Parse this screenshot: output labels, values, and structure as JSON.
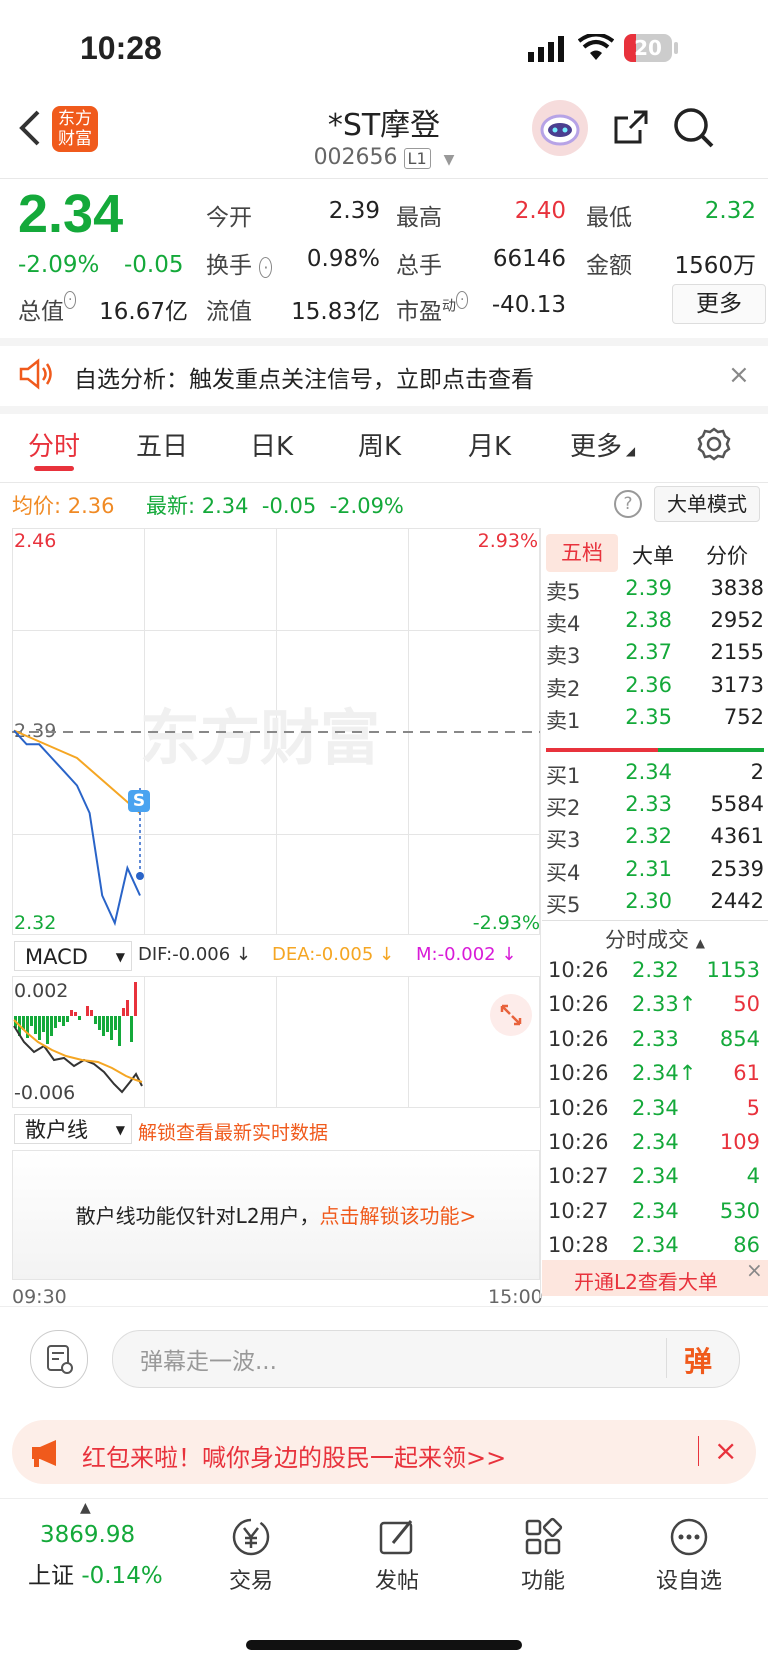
{
  "status": {
    "time": "10:28",
    "battery": "20"
  },
  "header": {
    "logo": "东方财富",
    "title": "*ST摩登",
    "code": "002656",
    "level": "L1"
  },
  "quote": {
    "price": "2.34",
    "change_pct": "-2.09%",
    "change": "-0.05",
    "open_label": "今开",
    "open": "2.39",
    "high_label": "最高",
    "high": "2.40",
    "low_label": "最低",
    "low": "2.32",
    "turnover_label": "换手",
    "turnover": "0.98%",
    "volume_label": "总手",
    "volume": "66146",
    "amount_label": "金额",
    "amount": "1560万",
    "mktcap_label": "总值",
    "mktcap": "16.67亿",
    "float_label": "流值",
    "float_cap": "15.83亿",
    "pe_label": "市盈",
    "pe_sup": "动",
    "pe": "-40.13",
    "more": "更多"
  },
  "notice": {
    "text": "自选分析：触发重点关注信号，立即点击查看"
  },
  "tabs": [
    "分时",
    "五日",
    "日K",
    "周K",
    "月K",
    "更多"
  ],
  "info_line": {
    "avg_label": "均价:",
    "avg": "2.36",
    "latest_label": "最新:",
    "latest": "2.34",
    "change": "-0.05",
    "pct": "-2.09%",
    "mode": "大单模式"
  },
  "chart": {
    "y_top": "2.46",
    "y_bottom": "2.32",
    "pct_top": "2.93%",
    "pct_bottom": "-2.93%",
    "ref_price": "2.39",
    "watermark": "东方财富",
    "time_start": "09:30",
    "time_end": "15:00",
    "s_marker": "S"
  },
  "chart_data": {
    "type": "line",
    "series": [
      {
        "values": [
          2.39,
          2.385,
          2.385,
          2.38,
          2.375,
          2.37,
          2.36,
          2.33,
          2.32,
          2.34,
          2.33
        ]
      },
      {
        "values": [
          2.39,
          2.388,
          2.386,
          2.384,
          2.382,
          2.38,
          2.376,
          2.372,
          2.368,
          2.364,
          2.36
        ]
      }
    ],
    "ylim": [
      2.32,
      2.46
    ],
    "x": [
      "09:30",
      "15:00"
    ]
  },
  "macd": {
    "name": "MACD",
    "dif": "DIF:-0.006 ↓",
    "dea": "DEA:-0.005 ↓",
    "m": "M:-0.002 ↓",
    "top": "0.002",
    "bottom": "-0.006"
  },
  "retail": {
    "name": "散户线",
    "unlock_link": "解锁查看最新实时数据",
    "msg": "散户线功能仅针对L2用户，",
    "msg_link": "点击解锁该功能>"
  },
  "orderbook": {
    "tabs": [
      "五档",
      "大单",
      "分价"
    ],
    "asks": [
      {
        "label": "卖5",
        "price": "2.39",
        "vol": "3838"
      },
      {
        "label": "卖4",
        "price": "2.38",
        "vol": "2952"
      },
      {
        "label": "卖3",
        "price": "2.37",
        "vol": "2155"
      },
      {
        "label": "卖2",
        "price": "2.36",
        "vol": "3173"
      },
      {
        "label": "卖1",
        "price": "2.35",
        "vol": "752"
      }
    ],
    "bids": [
      {
        "label": "买1",
        "price": "2.34",
        "vol": "2"
      },
      {
        "label": "买2",
        "price": "2.33",
        "vol": "5584"
      },
      {
        "label": "买3",
        "price": "2.32",
        "vol": "4361"
      },
      {
        "label": "买4",
        "price": "2.31",
        "vol": "2539"
      },
      {
        "label": "买5",
        "price": "2.30",
        "vol": "2442"
      }
    ]
  },
  "trades": {
    "title": "分时成交",
    "rows": [
      {
        "time": "10:26",
        "price": "2.32",
        "vol": "1153"
      },
      {
        "time": "10:26",
        "price": "2.33↑",
        "vol": "50"
      },
      {
        "time": "10:26",
        "price": "2.33",
        "vol": "854"
      },
      {
        "time": "10:26",
        "price": "2.34↑",
        "vol": "61"
      },
      {
        "time": "10:26",
        "price": "2.34",
        "vol": "5"
      },
      {
        "time": "10:26",
        "price": "2.34",
        "vol": "109"
      },
      {
        "time": "10:27",
        "price": "2.34",
        "vol": "4"
      },
      {
        "time": "10:27",
        "price": "2.34",
        "vol": "530"
      },
      {
        "time": "10:28",
        "price": "2.34",
        "vol": "86"
      }
    ],
    "l2_banner": "开通L2查看大单"
  },
  "comment": {
    "placeholder": "弹幕走一波...",
    "send": "弹"
  },
  "promo": {
    "text": "红包来啦！喊你身边的股民一起来领>>"
  },
  "bottom_nav": {
    "index_value": "3869.98",
    "index_name": "上证",
    "index_change": "-0.14%",
    "items": [
      "交易",
      "发帖",
      "功能",
      "设自选"
    ]
  }
}
